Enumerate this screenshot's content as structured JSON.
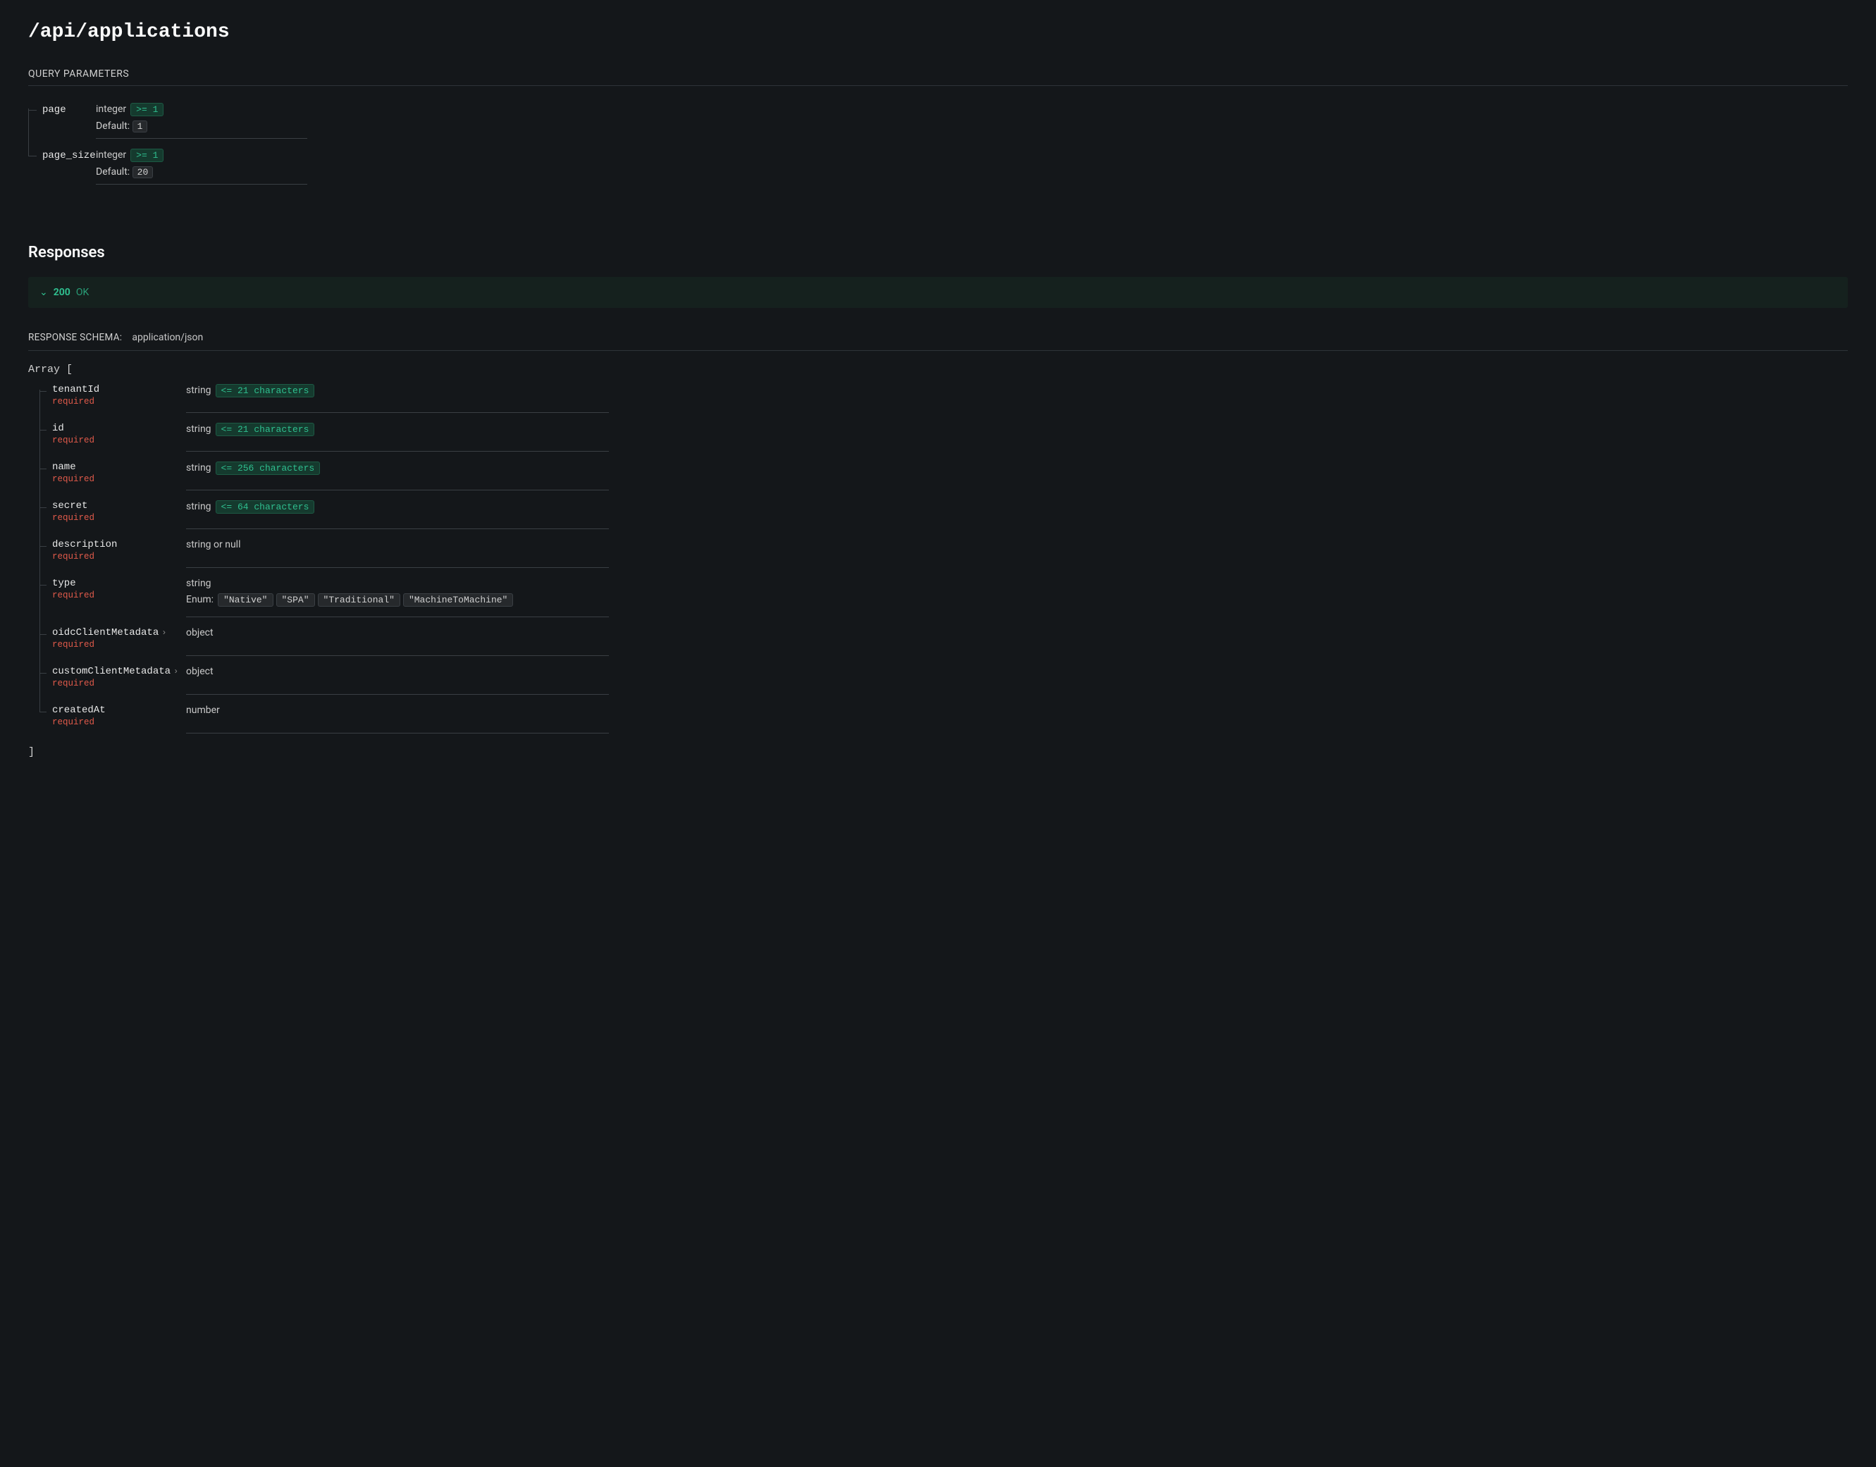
{
  "endpoint": "/api/applications",
  "query_section_label": "QUERY PARAMETERS",
  "query_params": [
    {
      "name": "page",
      "type": "integer",
      "constraint": ">= 1",
      "default_label": "Default:",
      "default": "1"
    },
    {
      "name": "page_size",
      "type": "integer",
      "constraint": ">= 1",
      "default_label": "Default:",
      "default": "20"
    }
  ],
  "responses_heading": "Responses",
  "response": {
    "code": "200",
    "status": "OK"
  },
  "schema_header": {
    "label": "RESPONSE SCHEMA:",
    "content_type": "application/json"
  },
  "array_open": "Array [",
  "array_close": "]",
  "required_label": "required",
  "enum_label": "Enum:",
  "fields": [
    {
      "name": "tenantId",
      "required": true,
      "type": "string",
      "constraint": "<= 21 characters"
    },
    {
      "name": "id",
      "required": true,
      "type": "string",
      "constraint": "<= 21 characters"
    },
    {
      "name": "name",
      "required": true,
      "type": "string",
      "constraint": "<= 256 characters"
    },
    {
      "name": "secret",
      "required": true,
      "type": "string",
      "constraint": "<= 64 characters"
    },
    {
      "name": "description",
      "required": true,
      "type": "string or null"
    },
    {
      "name": "type",
      "required": true,
      "type": "string",
      "enum": [
        "\"Native\"",
        "\"SPA\"",
        "\"Traditional\"",
        "\"MachineToMachine\""
      ]
    },
    {
      "name": "oidcClientMetadata",
      "required": true,
      "type": "object",
      "expandable": true
    },
    {
      "name": "customClientMetadata",
      "required": true,
      "type": "object",
      "expandable": true
    },
    {
      "name": "createdAt",
      "required": true,
      "type": "number"
    }
  ]
}
